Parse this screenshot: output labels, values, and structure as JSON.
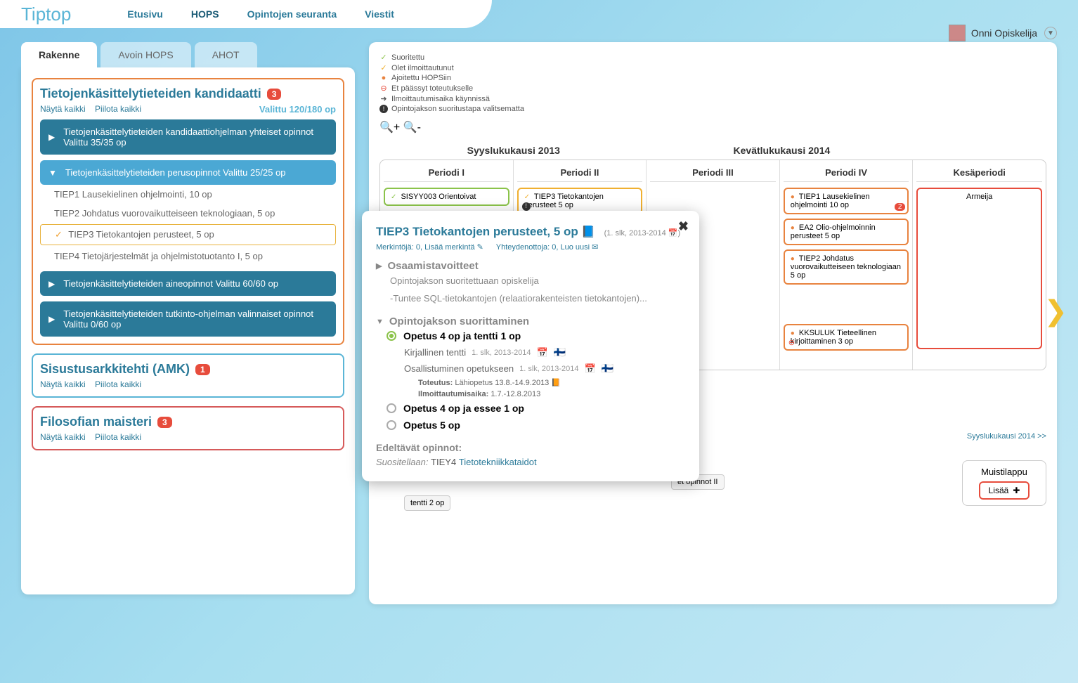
{
  "app": {
    "name": "Tiptop"
  },
  "topnav": {
    "items": [
      "Etusivu",
      "HOPS",
      "Opintojen seuranta",
      "Viestit"
    ],
    "active": 1
  },
  "user": {
    "name": "Onni Opiskelija"
  },
  "tabs": {
    "items": [
      "Rakenne",
      "Avoin HOPS",
      "AHOT"
    ],
    "active": 0
  },
  "programs": [
    {
      "title": "Tietojenkäsittelytieteiden kandidaatti",
      "badge": "3",
      "show_all": "Näytä kaikki",
      "hide_all": "Piilota kaikki",
      "selected": "Valittu 120/180 op",
      "sections": [
        {
          "label": "Tietojenkäsittelytieteiden kandidaattiohjelman yhteiset opinnot Valittu 35/35 op",
          "expanded": false
        },
        {
          "label": "Tietojenkäsittelytieteiden perusopinnot Valittu 25/25 op",
          "expanded": true,
          "courses": [
            {
              "text": "TIEP1 Lausekielinen ohjelmointi, 10 op"
            },
            {
              "text": "TIEP2 Johdatus vuorovaikutteiseen teknologiaan, 5 op"
            },
            {
              "text": "TIEP3 Tietokantojen perusteet, 5 op",
              "selected": true
            },
            {
              "text": "TIEP4 Tietojärjestelmät ja ohjelmistotuotanto I, 5 op"
            }
          ]
        },
        {
          "label": "Tietojenkäsittelytieteiden aineopinnot Valittu 60/60 op",
          "expanded": false
        },
        {
          "label": "Tietojenkäsittelytieteiden tutkinto-ohjelman valinnaiset opinnot Valittu 0/60 op",
          "expanded": false
        }
      ]
    },
    {
      "title": "Sisustusarkkitehti (AMK)",
      "badge": "1",
      "show_all": "Näytä kaikki",
      "hide_all": "Piilota kaikki"
    },
    {
      "title": "Filosofian maisteri",
      "badge": "3",
      "show_all": "Näytä kaikki",
      "hide_all": "Piilota kaikki"
    }
  ],
  "legend": [
    {
      "icon": "✓",
      "color": "#8bc34a",
      "text": "Suoritettu"
    },
    {
      "icon": "✓",
      "color": "#f0b030",
      "text": "Olet ilmoittautunut"
    },
    {
      "icon": "●",
      "color": "#e8833f",
      "text": "Ajoitettu HOPSiin"
    },
    {
      "icon": "⊖",
      "color": "#e74c3c",
      "text": "Et päässyt toteutukselle"
    },
    {
      "icon": "➜",
      "color": "#333",
      "text": "Ilmoittautumisaika käynnissä"
    },
    {
      "icon": "!",
      "color": "#333",
      "text": "Opintojakson suoritustapa valitsematta"
    }
  ],
  "semesters": {
    "fall": "Syyslukukausi 2013",
    "spring": "Kevätlukukausi 2014"
  },
  "periods": [
    "Periodi I",
    "Periodi II",
    "Periodi III",
    "Periodi IV",
    "Kesäperiodi"
  ],
  "timeline": {
    "p1": [
      {
        "type": "green",
        "icon": "✓",
        "text": "SISYY003 Orientoivat"
      }
    ],
    "p2": [
      {
        "type": "yellow",
        "icon": "✓",
        "text": "TIEP3 Tietokantojen perusteet 5 op",
        "warn": true
      }
    ],
    "p4": [
      {
        "type": "orange",
        "icon": "●",
        "text": "TIEP1 Lausekielinen ohjelmointi 10 op",
        "badge": "2"
      },
      {
        "type": "orange",
        "icon": "●",
        "text": "EA2 Olio-ohjelmoinnin perusteet 5 op"
      },
      {
        "type": "orange",
        "icon": "●",
        "text": "TIEP2 Johdatus vuorovaikutteiseen teknologiaan 5 op"
      },
      {
        "type": "orange",
        "icon": "●",
        "text": "KKSULUK Tieteellinen kirjoittaminen 3 op",
        "blocked": true
      }
    ],
    "p5": [
      {
        "type": "red",
        "text": "Armeija"
      }
    ],
    "bottom": [
      {
        "text": "et opinnot II"
      },
      {
        "text": "tentti 2 op"
      }
    ]
  },
  "next_link": "Syyslukukausi 2014 >>",
  "muistilappu": {
    "title": "Muistilappu",
    "button": "Lisää"
  },
  "popup": {
    "title": "TIEP3 Tietokantojen perusteet, 5 op",
    "meta": "(1. slk, 2013-2014 📅)",
    "link1": "Merkintöjä: 0, Lisää merkintä ✎",
    "link2": "Yhteydenottoja: 0, Luo uusi ✉",
    "goals_title": "Osaamistavoitteet",
    "goals_text1": "Opintojakson suoritettuaan opiskelija",
    "goals_text2": "-Tuntee SQL-tietokantojen (relaatiorakenteisten tietokantojen)...",
    "completion_title": "Opintojakson suorittaminen",
    "options": [
      {
        "label": "Opetus 4 op ja tentti 1 op",
        "selected": true,
        "details": [
          {
            "label": "Kirjallinen tentti",
            "meta": "1. slk, 2013-2014",
            "cal": true,
            "flag": true
          },
          {
            "label": "Osallistuminen opetukseen",
            "meta": "1. slk, 2013-2014",
            "cal": true,
            "flag": true,
            "info": [
              {
                "k": "Toteutus:",
                "v": "Lähiopetus 13.8.-14.9.2013 📙"
              },
              {
                "k": "Ilmoittautumisaika:",
                "v": "1.7.-12.8.2013"
              }
            ]
          }
        ]
      },
      {
        "label": "Opetus 4 op ja essee 1 op",
        "selected": false
      },
      {
        "label": "Opetus 5 op",
        "selected": false
      }
    ],
    "prereq_title": "Edeltävät opinnot:",
    "prereq_text": "Suositellaan:",
    "prereq_course": "TIEY4",
    "prereq_link": "Tietotekniikkataidot"
  }
}
